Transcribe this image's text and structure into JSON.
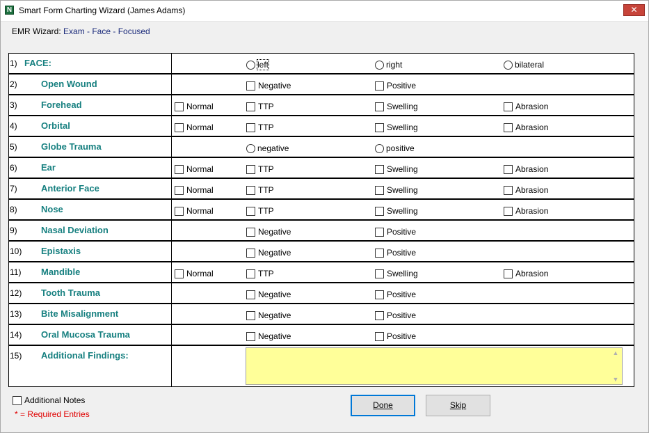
{
  "window": {
    "title": "Smart Form Charting Wizard (James Adams)",
    "close_glyph": "✕",
    "app_icon_glyph": "N"
  },
  "wizard": {
    "prefix": "EMR Wizard:",
    "path": "Exam - Face - Focused"
  },
  "rows": [
    {
      "num": "1)",
      "label": "FACE:",
      "options": [
        {
          "type": "radio",
          "label": "left"
        },
        {
          "type": "radio",
          "label": "right"
        },
        {
          "type": "radio",
          "label": "bilateral"
        }
      ]
    },
    {
      "num": "2)",
      "label": "Open Wound",
      "options": [
        {
          "type": "checkbox",
          "label": "Negative"
        },
        {
          "type": "checkbox",
          "label": "Positive"
        }
      ]
    },
    {
      "num": "3)",
      "label": "Forehead",
      "options": [
        {
          "type": "checkbox",
          "label": "Normal"
        },
        {
          "type": "checkbox",
          "label": "TTP"
        },
        {
          "type": "checkbox",
          "label": "Swelling"
        },
        {
          "type": "checkbox",
          "label": "Abrasion"
        }
      ]
    },
    {
      "num": "4)",
      "label": "Orbital",
      "options": [
        {
          "type": "checkbox",
          "label": "Normal"
        },
        {
          "type": "checkbox",
          "label": "TTP"
        },
        {
          "type": "checkbox",
          "label": "Swelling"
        },
        {
          "type": "checkbox",
          "label": "Abrasion"
        }
      ]
    },
    {
      "num": "5)",
      "label": "Globe Trauma",
      "options": [
        {
          "type": "radio",
          "label": "negative"
        },
        {
          "type": "radio",
          "label": "positive"
        }
      ]
    },
    {
      "num": "6)",
      "label": "Ear",
      "options": [
        {
          "type": "checkbox",
          "label": "Normal"
        },
        {
          "type": "checkbox",
          "label": "TTP"
        },
        {
          "type": "checkbox",
          "label": "Swelling"
        },
        {
          "type": "checkbox",
          "label": "Abrasion"
        }
      ]
    },
    {
      "num": "7)",
      "label": "Anterior Face",
      "options": [
        {
          "type": "checkbox",
          "label": "Normal"
        },
        {
          "type": "checkbox",
          "label": "TTP"
        },
        {
          "type": "checkbox",
          "label": "Swelling"
        },
        {
          "type": "checkbox",
          "label": "Abrasion"
        }
      ]
    },
    {
      "num": "8)",
      "label": "Nose",
      "options": [
        {
          "type": "checkbox",
          "label": "Normal"
        },
        {
          "type": "checkbox",
          "label": "TTP"
        },
        {
          "type": "checkbox",
          "label": "Swelling"
        },
        {
          "type": "checkbox",
          "label": "Abrasion"
        }
      ]
    },
    {
      "num": "9)",
      "label": "Nasal Deviation",
      "options": [
        {
          "type": "checkbox",
          "label": "Negative"
        },
        {
          "type": "checkbox",
          "label": "Positive"
        }
      ]
    },
    {
      "num": "10)",
      "label": "Epistaxis",
      "options": [
        {
          "type": "checkbox",
          "label": "Negative"
        },
        {
          "type": "checkbox",
          "label": "Positive"
        }
      ]
    },
    {
      "num": "11)",
      "label": "Mandible",
      "options": [
        {
          "type": "checkbox",
          "label": "Normal"
        },
        {
          "type": "checkbox",
          "label": "TTP"
        },
        {
          "type": "checkbox",
          "label": "Swelling"
        },
        {
          "type": "checkbox",
          "label": "Abrasion"
        }
      ]
    },
    {
      "num": "12)",
      "label": "Tooth Trauma",
      "options": [
        {
          "type": "checkbox",
          "label": "Negative"
        },
        {
          "type": "checkbox",
          "label": "Positive"
        }
      ]
    },
    {
      "num": "13)",
      "label": "Bite Misalignment",
      "options": [
        {
          "type": "checkbox",
          "label": "Negative"
        },
        {
          "type": "checkbox",
          "label": "Positive"
        }
      ]
    },
    {
      "num": "14)",
      "label": "Oral Mucosa Trauma",
      "options": [
        {
          "type": "checkbox",
          "label": "Negative"
        },
        {
          "type": "checkbox",
          "label": "Positive"
        }
      ]
    }
  ],
  "findings": {
    "num": "15)",
    "label": "Additional Findings:",
    "value": "",
    "background": "#ffff99"
  },
  "footer": {
    "additional_notes_label": "Additional Notes",
    "required_text": "* = Required Entries",
    "done_label": "Done",
    "skip_label": "Skip"
  },
  "colors": {
    "label_teal": "#178080",
    "path_blue": "#1a2a7a",
    "required_red": "#e00000",
    "focus_blue": "#0078d7"
  }
}
